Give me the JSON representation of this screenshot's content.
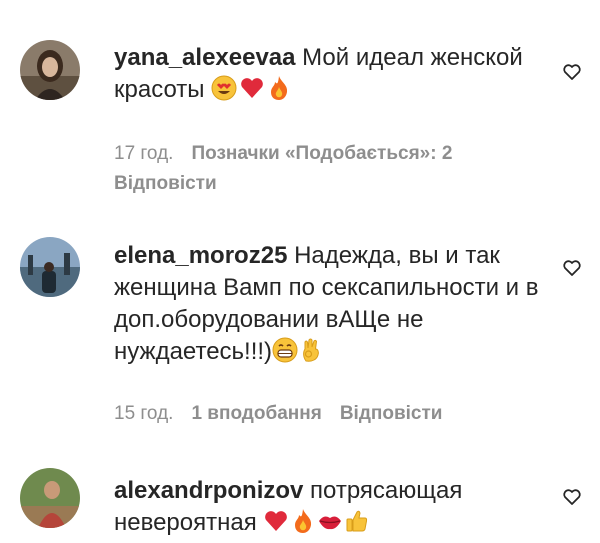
{
  "comments": [
    {
      "username": "yana_alexeevaa",
      "text": "Мой идеал женской красоты",
      "emojis": [
        "heart-eyes-emoji",
        "red-heart-emoji",
        "fire-emoji"
      ],
      "time": "17 год.",
      "likes_label": "Позначки «Подобається»: 2",
      "reply_label": "Відповісти"
    },
    {
      "username": "elena_moroz25",
      "text": "Надежда, вы и так женщина Вамп по сексапильности и в доп.оборудовании вАЩе не нуждаетесь!!!)",
      "emojis": [
        "grinning-emoji",
        "ok-hand-emoji"
      ],
      "time": "15 год.",
      "likes_label": "1 вподобання",
      "reply_label": "Відповісти"
    },
    {
      "username": "alexandrponizov",
      "text": "потрясающая невероятная",
      "emojis": [
        "red-heart-emoji",
        "fire-emoji",
        "kiss-lips-emoji",
        "thumbs-up-emoji"
      ]
    }
  ],
  "colors": {
    "text": "#262626",
    "meta": "#8e8e8e",
    "heart_outline": "#262626"
  }
}
